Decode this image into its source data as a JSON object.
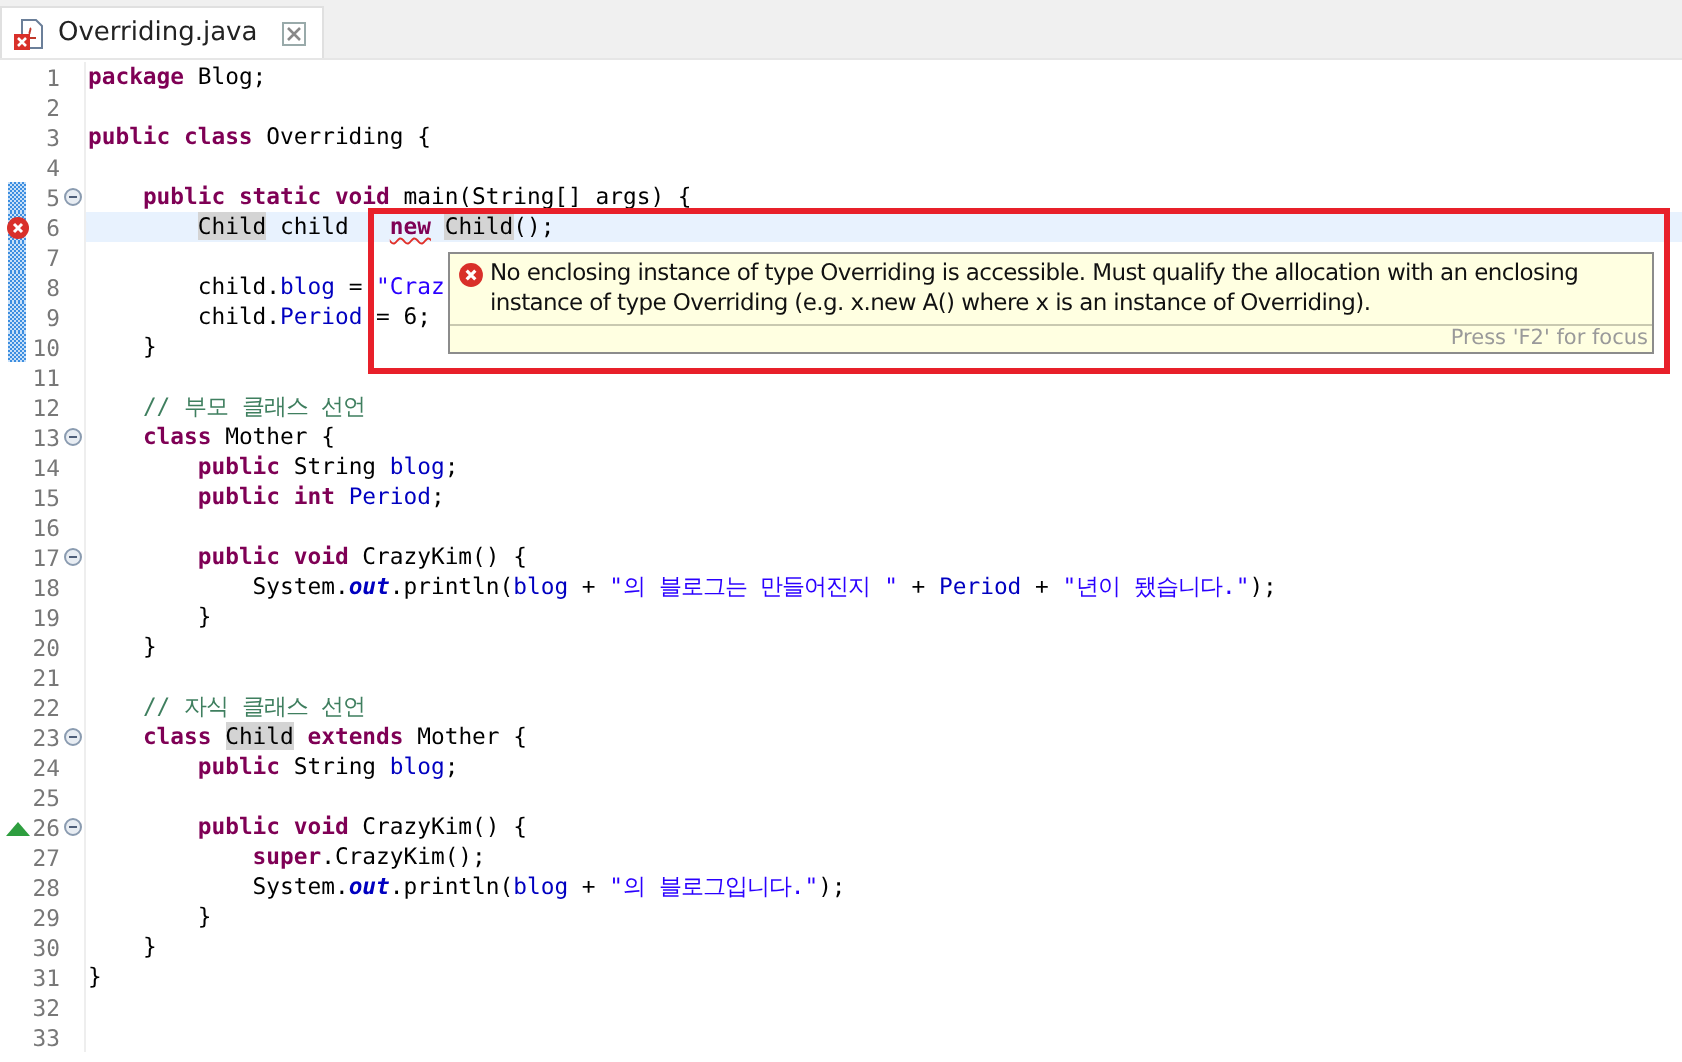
{
  "tab": {
    "title": "Overriding.java",
    "has_error": true,
    "selected": true
  },
  "lines": [
    {
      "number": "1",
      "tokens": [
        {
          "t": "package",
          "kind": "kw"
        },
        {
          "t": " Blog;",
          "kind": "plain"
        }
      ]
    },
    {
      "number": "2"
    },
    {
      "number": "3",
      "tokens": [
        {
          "t": "public class",
          "kind": "kw"
        },
        {
          "t": " Overriding {",
          "kind": "plain"
        }
      ]
    },
    {
      "number": "4"
    },
    {
      "number": "5",
      "fold": true,
      "changed": true,
      "tokens": [
        {
          "t": "    public static void",
          "kind": "kw"
        },
        {
          "t": " main(String[] args) {",
          "kind": "plain"
        }
      ]
    },
    {
      "number": "6",
      "error_marker": true,
      "changed": true,
      "current": true,
      "tokens": [
        {
          "t": "        Child",
          "kind": "occurrence"
        },
        {
          "t": " child   ",
          "kind": "plain"
        },
        {
          "t": "new",
          "kind": "error"
        },
        {
          "t": " Child",
          "kind": "occurrence"
        },
        {
          "t": "();",
          "kind": "plain"
        }
      ]
    },
    {
      "number": "7",
      "changed": true
    },
    {
      "number": "8",
      "changed": true,
      "tokens": [
        {
          "t": "        child.",
          "kind": "plain"
        },
        {
          "t": "blog",
          "kind": "field"
        },
        {
          "t": " = ",
          "kind": "plain"
        },
        {
          "t": "\"Craz",
          "kind": "string"
        }
      ]
    },
    {
      "number": "9",
      "changed": true,
      "tokens": [
        {
          "t": "        child.",
          "kind": "plain"
        },
        {
          "t": "Period",
          "kind": "field"
        },
        {
          "t": " = 6;",
          "kind": "plain"
        }
      ]
    },
    {
      "number": "10",
      "changed": true,
      "tokens": [
        {
          "t": "    }",
          "kind": "plain"
        }
      ]
    },
    {
      "number": "11"
    },
    {
      "number": "12",
      "tokens": [
        {
          "t": "    // 부모 클래스 선언",
          "kind": "comment"
        }
      ]
    },
    {
      "number": "13",
      "fold": true,
      "tokens": [
        {
          "t": "    class",
          "kind": "kw"
        },
        {
          "t": " Mother {",
          "kind": "plain"
        }
      ]
    },
    {
      "number": "14",
      "tokens": [
        {
          "t": "        public",
          "kind": "kw"
        },
        {
          "t": " String ",
          "kind": "plain"
        },
        {
          "t": "blog",
          "kind": "field"
        },
        {
          "t": ";",
          "kind": "plain"
        }
      ]
    },
    {
      "number": "15",
      "tokens": [
        {
          "t": "        public int",
          "kind": "kw"
        },
        {
          "t": " Period",
          "kind": "field"
        },
        {
          "t": ";",
          "kind": "plain"
        }
      ]
    },
    {
      "number": "16"
    },
    {
      "number": "17",
      "fold": true,
      "tokens": [
        {
          "t": "        public void",
          "kind": "kw"
        },
        {
          "t": " CrazyKim() {",
          "kind": "plain"
        }
      ]
    },
    {
      "number": "18",
      "tokens": [
        {
          "t": "            System.",
          "kind": "plain"
        },
        {
          "t": "out",
          "kind": "static"
        },
        {
          "t": ".println(",
          "kind": "plain"
        },
        {
          "t": "blog",
          "kind": "field"
        },
        {
          "t": " + ",
          "kind": "plain"
        },
        {
          "t": "\"의 블로그는 만들어진지 \"",
          "kind": "string"
        },
        {
          "t": " + ",
          "kind": "plain"
        },
        {
          "t": "Period",
          "kind": "field"
        },
        {
          "t": " + ",
          "kind": "plain"
        },
        {
          "t": "\"년이 됐습니다.\"",
          "kind": "string"
        },
        {
          "t": ");",
          "kind": "plain"
        }
      ]
    },
    {
      "number": "19",
      "tokens": [
        {
          "t": "        }",
          "kind": "plain"
        }
      ]
    },
    {
      "number": "20",
      "tokens": [
        {
          "t": "    }",
          "kind": "plain"
        }
      ]
    },
    {
      "number": "21"
    },
    {
      "number": "22",
      "tokens": [
        {
          "t": "    // 자식 클래스 선언",
          "kind": "comment"
        }
      ]
    },
    {
      "number": "23",
      "fold": true,
      "tokens": [
        {
          "t": "    class",
          "kind": "kw"
        },
        {
          "t": " Child",
          "kind": "occurrence"
        },
        {
          "t": " extends",
          "kind": "kw"
        },
        {
          "t": " Mother {",
          "kind": "plain"
        }
      ]
    },
    {
      "number": "24",
      "tokens": [
        {
          "t": "        public",
          "kind": "kw"
        },
        {
          "t": " String ",
          "kind": "plain"
        },
        {
          "t": "blog",
          "kind": "field"
        },
        {
          "t": ";",
          "kind": "plain"
        }
      ]
    },
    {
      "number": "25"
    },
    {
      "number": "26",
      "fold": true,
      "override_marker": true,
      "tokens": [
        {
          "t": "        public void",
          "kind": "kw"
        },
        {
          "t": " CrazyKim() {",
          "kind": "plain"
        }
      ]
    },
    {
      "number": "27",
      "tokens": [
        {
          "t": "            super",
          "kind": "kw"
        },
        {
          "t": ".CrazyKim();",
          "kind": "plain"
        }
      ]
    },
    {
      "number": "28",
      "tokens": [
        {
          "t": "            System.",
          "kind": "plain"
        },
        {
          "t": "out",
          "kind": "static"
        },
        {
          "t": ".println(",
          "kind": "plain"
        },
        {
          "t": "blog",
          "kind": "field"
        },
        {
          "t": " + ",
          "kind": "plain"
        },
        {
          "t": "\"의 블로그입니다.\"",
          "kind": "string"
        },
        {
          "t": ");",
          "kind": "plain"
        }
      ]
    },
    {
      "number": "29",
      "tokens": [
        {
          "t": "        }",
          "kind": "plain"
        }
      ]
    },
    {
      "number": "30",
      "tokens": [
        {
          "t": "    }",
          "kind": "plain"
        }
      ]
    },
    {
      "number": "31",
      "tokens": [
        {
          "t": "}",
          "kind": "plain"
        }
      ]
    },
    {
      "number": "32"
    },
    {
      "number": "33"
    }
  ],
  "hover": {
    "message": "No enclosing instance of type Overriding is accessible. Must qualify the allocation with an enclosing instance of type Overriding (e.g. x.new A() where x is an instance of Overriding).",
    "hint": "Press 'F2' for focus"
  }
}
